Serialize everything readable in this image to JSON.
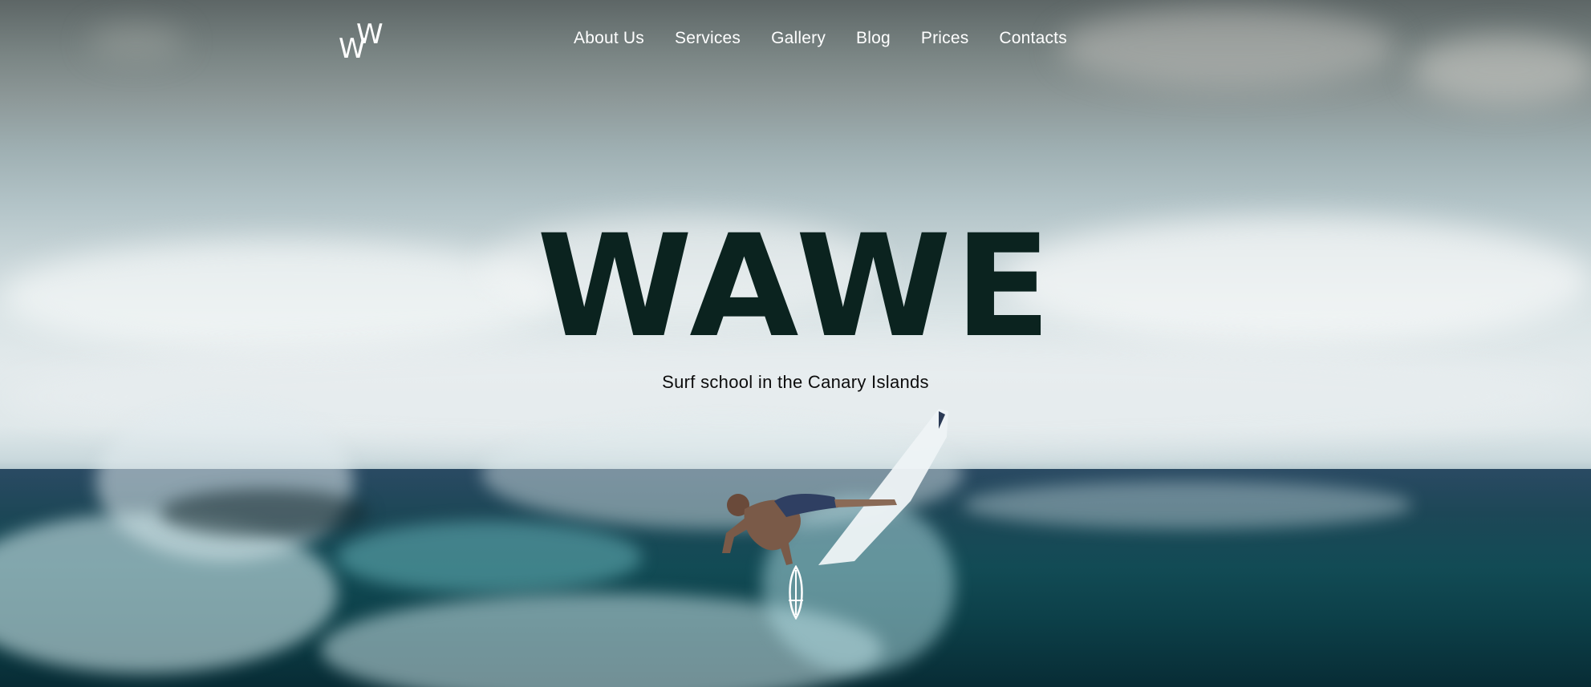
{
  "brand": {
    "logo_icon": "wawe-logo-icon",
    "logo_text": "WW"
  },
  "nav": {
    "items": [
      {
        "label": "About Us"
      },
      {
        "label": "Services"
      },
      {
        "label": "Gallery"
      },
      {
        "label": "Blog"
      },
      {
        "label": "Prices"
      },
      {
        "label": "Contacts"
      }
    ]
  },
  "hero": {
    "title": "WAWE",
    "subtitle": "Surf school in the Canary Islands",
    "background": "surfer-on-wave-photo",
    "scroll_icon": "surfboard-scroll-icon"
  },
  "colors": {
    "title": "#0b231f",
    "nav_text": "#ffffff",
    "subtitle": "#0c0c0c"
  }
}
